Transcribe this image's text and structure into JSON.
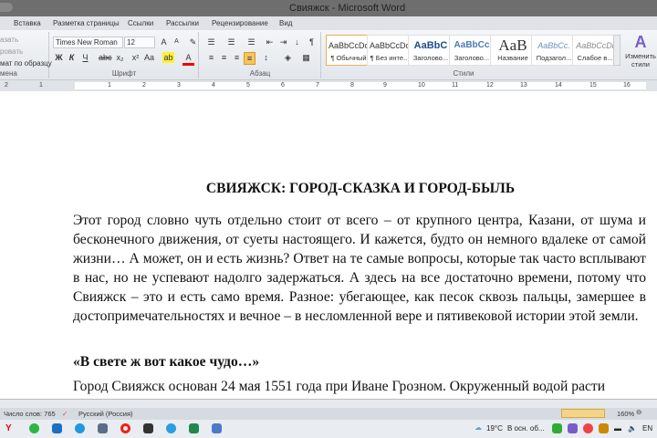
{
  "window": {
    "title": "Свияжск - Microsoft Word"
  },
  "tabs": [
    "Вставка",
    "Разметка страницы",
    "Ссылки",
    "Рассылки",
    "Рецензирование",
    "Вид"
  ],
  "clipboard": {
    "items": [
      "азать",
      "ровать",
      "мат по образцу"
    ],
    "label": "мена"
  },
  "font": {
    "name": "Times New Roman",
    "size": "12",
    "label": "Шрифт"
  },
  "paragraph": {
    "label": "Абзац"
  },
  "styles": {
    "label": "Стили",
    "items": [
      {
        "sample": "AaBbCcDc",
        "name": "¶ Обычный"
      },
      {
        "sample": "AaBbCcDc",
        "name": "¶ Без инте..."
      },
      {
        "sample": "AaBbC",
        "name": "Заголово..."
      },
      {
        "sample": "AaBbCc",
        "name": "Заголово..."
      },
      {
        "sample": "AaB",
        "name": "Название"
      },
      {
        "sample": "AaBbCc.",
        "name": "Подзагол..."
      },
      {
        "sample": "AaBbCcDi",
        "name": "Слабое в..."
      }
    ],
    "change": "Изменить стили"
  },
  "ruler": [
    "2",
    "1",
    "1",
    "2",
    "3",
    "4",
    "5",
    "6",
    "7",
    "8",
    "9",
    "10",
    "11",
    "12",
    "13",
    "14",
    "15",
    "16"
  ],
  "document": {
    "title": "СВИЯЖСК: ГОРОД-СКАЗКА И ГОРОД-БЫЛЬ",
    "paragraph1": "Этот город словно чуть отдельно стоит от всего – от крупного центра, Казани, от шума и бесконечного движения, от суеты настоящего. И кажется, будто он немного вдалеке от самой жизни… А может, он и есть жизнь? Ответ на те самые вопросы, которые так часто всплывают в нас, но не успевают надолго задержаться. А здесь на все достаточно времени, потому что Свияжск – это и есть само время. Разное: убегающее, как песок сквозь пальцы, замершее в достопримечательностях и вечное – в несломленной вере и пятивековой истории этой земли.",
    "subheading": "«В свете ж вот какое чудо…»",
    "partial_line": "Город Свияжск основан 24 мая 1551 года при Иване Грозном. Окруженный водой расти"
  },
  "status": {
    "words": "Число слов: 765",
    "language": "Русский (Россия)",
    "zoom": "160%"
  },
  "taskbar": {
    "weather": "19°C",
    "news": "В осн. об...",
    "lang": "EN"
  }
}
